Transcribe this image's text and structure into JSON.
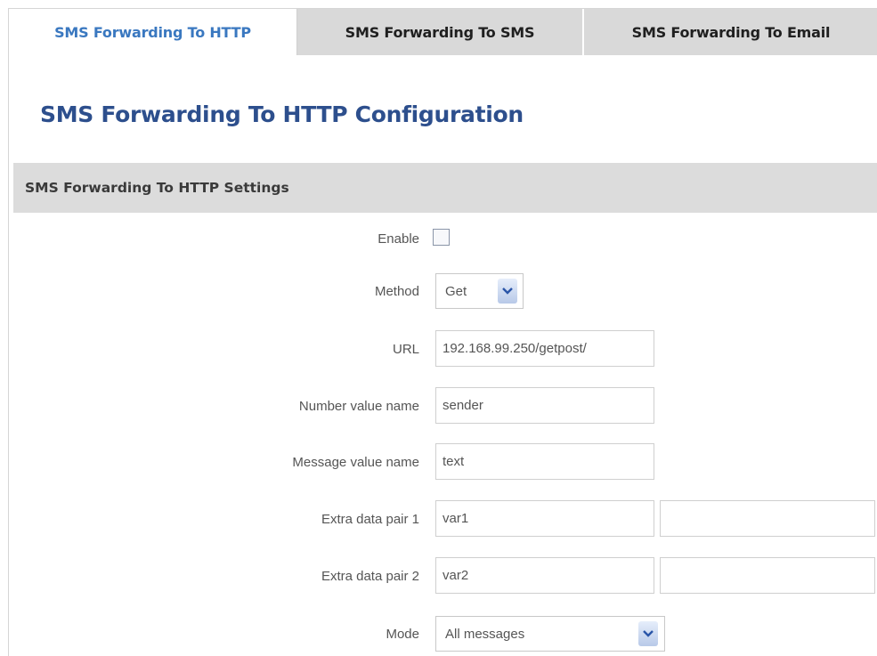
{
  "tabs": [
    {
      "label": "SMS Forwarding To HTTP",
      "active": true
    },
    {
      "label": "SMS Forwarding To SMS",
      "active": false
    },
    {
      "label": "SMS Forwarding To Email",
      "active": false
    }
  ],
  "page_title": "SMS Forwarding To HTTP Configuration",
  "section_title": "SMS Forwarding To HTTP Settings",
  "form": {
    "enable": {
      "label": "Enable",
      "checked": false
    },
    "method": {
      "label": "Method",
      "value": "Get"
    },
    "url": {
      "label": "URL",
      "value": "192.168.99.250/getpost/"
    },
    "number_value_name": {
      "label": "Number value name",
      "value": "sender"
    },
    "message_value_name": {
      "label": "Message value name",
      "value": "text"
    },
    "extra_data_pair_1": {
      "label": "Extra data pair 1",
      "key": "var1",
      "value": ""
    },
    "extra_data_pair_2": {
      "label": "Extra data pair 2",
      "key": "var2",
      "value": ""
    },
    "mode": {
      "label": "Mode",
      "value": "All messages"
    }
  },
  "colors": {
    "active_tab_text": "#3a78c0",
    "title": "#2d4f8d",
    "inactive_tab_bg": "#d9d9d9",
    "section_bg": "#dcdcdc"
  }
}
